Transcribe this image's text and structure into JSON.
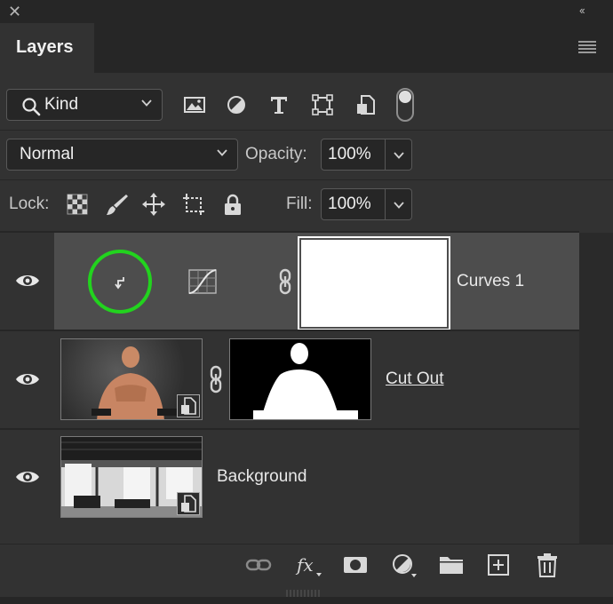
{
  "panel": {
    "tab_label": "Layers"
  },
  "filter": {
    "kind_label": "Kind"
  },
  "blend": {
    "mode": "Normal",
    "opacity_label": "Opacity:",
    "opacity_value": "100%"
  },
  "lock": {
    "label": "Lock:",
    "fill_label": "Fill:",
    "fill_value": "100%"
  },
  "layers": [
    {
      "name": "Curves 1",
      "type": "adjustment",
      "visible": true,
      "selected": true
    },
    {
      "name": "Cut Out",
      "type": "smart-object-with-mask",
      "visible": true,
      "selected": false
    },
    {
      "name": "Background",
      "type": "smart-object",
      "visible": true,
      "selected": false
    }
  ],
  "colors": {
    "panel_bg": "#323232",
    "header_bg": "#262626",
    "selected_row": "#4d4d4d",
    "highlight_circle": "#22d31e"
  }
}
